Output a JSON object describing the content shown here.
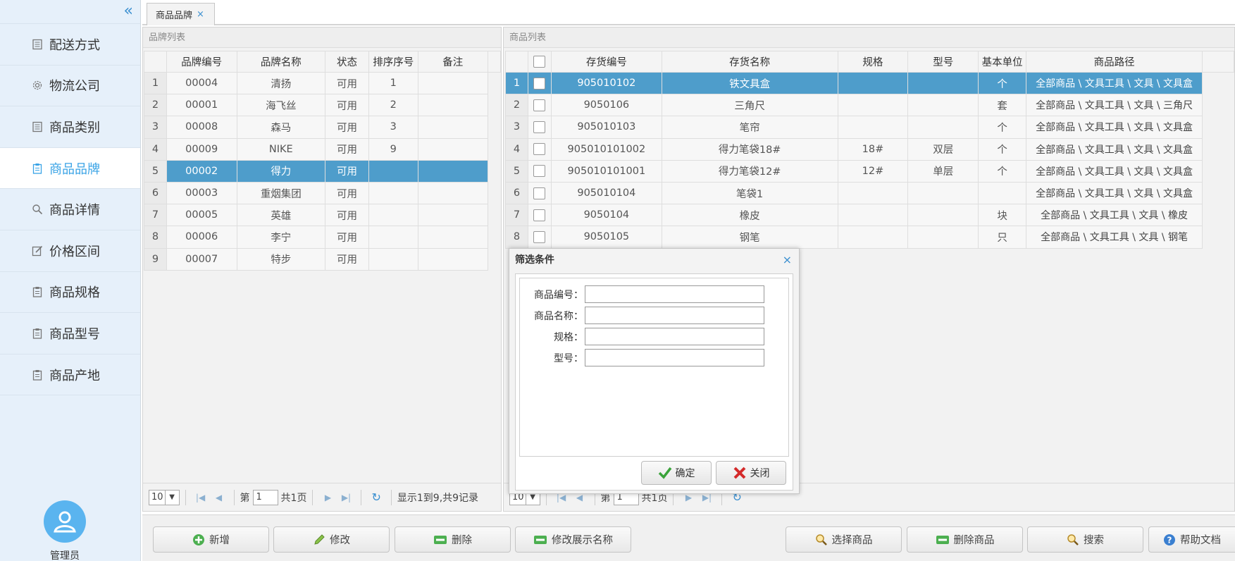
{
  "sidebar": {
    "collapse_icon": "double-chevron-left-icon",
    "items": [
      {
        "label": "配送方式",
        "icon": "list-icon",
        "active": false
      },
      {
        "label": "物流公司",
        "icon": "gear-icon",
        "active": false
      },
      {
        "label": "商品类别",
        "icon": "list-icon",
        "active": false
      },
      {
        "label": "商品品牌",
        "icon": "clipboard-icon",
        "active": true
      },
      {
        "label": "商品详情",
        "icon": "search-icon",
        "active": false
      },
      {
        "label": "价格区间",
        "icon": "edit-icon",
        "active": false
      },
      {
        "label": "商品规格",
        "icon": "clipboard-icon",
        "active": false
      },
      {
        "label": "商品型号",
        "icon": "clipboard-icon",
        "active": false
      },
      {
        "label": "商品产地",
        "icon": "clipboard-icon",
        "active": false
      }
    ],
    "user": {
      "name": "管理员"
    }
  },
  "tabs": [
    {
      "label": "商品品牌",
      "close": "×"
    }
  ],
  "brand_panel": {
    "title": "品牌列表",
    "columns": [
      "品牌编号",
      "品牌名称",
      "状态",
      "排序序号",
      "备注"
    ],
    "rows": [
      {
        "n": "1",
        "code": "00004",
        "name": "清扬",
        "status": "可用",
        "order": "1",
        "note": ""
      },
      {
        "n": "2",
        "code": "00001",
        "name": "海飞丝",
        "status": "可用",
        "order": "2",
        "note": ""
      },
      {
        "n": "3",
        "code": "00008",
        "name": "森马",
        "status": "可用",
        "order": "3",
        "note": ""
      },
      {
        "n": "4",
        "code": "00009",
        "name": "NIKE",
        "status": "可用",
        "order": "9",
        "note": ""
      },
      {
        "n": "5",
        "code": "00002",
        "name": "得力",
        "status": "可用",
        "order": "",
        "note": ""
      },
      {
        "n": "6",
        "code": "00003",
        "name": "重烟集团",
        "status": "可用",
        "order": "",
        "note": ""
      },
      {
        "n": "7",
        "code": "00005",
        "name": "英雄",
        "status": "可用",
        "order": "",
        "note": ""
      },
      {
        "n": "8",
        "code": "00006",
        "name": "李宁",
        "status": "可用",
        "order": "",
        "note": ""
      },
      {
        "n": "9",
        "code": "00007",
        "name": "特步",
        "status": "可用",
        "order": "",
        "note": ""
      }
    ],
    "selected_row": 5,
    "pager": {
      "page_size": "10",
      "page_prefix": "第",
      "page": "1",
      "page_total": "共1页",
      "summary": "显示1到9,共9记录"
    }
  },
  "goods_panel": {
    "title": "商品列表",
    "columns": [
      "存货编号",
      "存货名称",
      "规格",
      "型号",
      "基本单位",
      "商品路径"
    ],
    "rows": [
      {
        "n": "1",
        "code": "905010102",
        "name": "铁文具盒",
        "spec": "",
        "model": "",
        "unit": "个",
        "path": "全部商品 \\ 文具工具 \\ 文具 \\ 文具盒"
      },
      {
        "n": "2",
        "code": "9050106",
        "name": "三角尺",
        "spec": "",
        "model": "",
        "unit": "套",
        "path": "全部商品 \\ 文具工具 \\ 文具 \\ 三角尺"
      },
      {
        "n": "3",
        "code": "905010103",
        "name": "笔帘",
        "spec": "",
        "model": "",
        "unit": "个",
        "path": "全部商品 \\ 文具工具 \\ 文具 \\ 文具盒"
      },
      {
        "n": "4",
        "code": "905010101002",
        "name": "得力笔袋18#",
        "spec": "18#",
        "model": "双层",
        "unit": "个",
        "path": "全部商品 \\ 文具工具 \\ 文具 \\ 文具盒"
      },
      {
        "n": "5",
        "code": "905010101001",
        "name": "得力笔袋12#",
        "spec": "12#",
        "model": "单层",
        "unit": "个",
        "path": "全部商品 \\ 文具工具 \\ 文具 \\ 文具盒"
      },
      {
        "n": "6",
        "code": "905010104",
        "name": "笔袋1",
        "spec": "",
        "model": "",
        "unit": "",
        "path": "全部商品 \\ 文具工具 \\ 文具 \\ 文具盒"
      },
      {
        "n": "7",
        "code": "9050104",
        "name": "橡皮",
        "spec": "",
        "model": "",
        "unit": "块",
        "path": "全部商品 \\ 文具工具 \\ 文具 \\ 橡皮"
      },
      {
        "n": "8",
        "code": "9050105",
        "name": "钢笔",
        "spec": "",
        "model": "",
        "unit": "只",
        "path": "全部商品 \\ 文具工具 \\ 文具 \\ 钢笔"
      }
    ],
    "selected_row": 1,
    "pager": {
      "page_size": "10",
      "page_prefix": "第",
      "page": "1",
      "page_total": "共1页"
    }
  },
  "dialog": {
    "title": "筛选条件",
    "close": "×",
    "fields": [
      {
        "label": "商品编号：",
        "value": ""
      },
      {
        "label": "商品名称：",
        "value": ""
      },
      {
        "label": "规格：",
        "value": ""
      },
      {
        "label": "型号：",
        "value": ""
      }
    ],
    "confirm_label": "确定",
    "cancel_label": "关闭"
  },
  "toolbar": {
    "add": "新增",
    "edit": "修改",
    "delete": "删除",
    "edit_display_name": "修改展示名称",
    "select_goods": "选择商品",
    "delete_goods": "删除商品",
    "search": "搜索",
    "help": "帮助文档"
  },
  "colors": {
    "accent": "#39a3e6",
    "selected_row": "#4e9dcb",
    "sidebar_bg": "#e6f0fa"
  }
}
